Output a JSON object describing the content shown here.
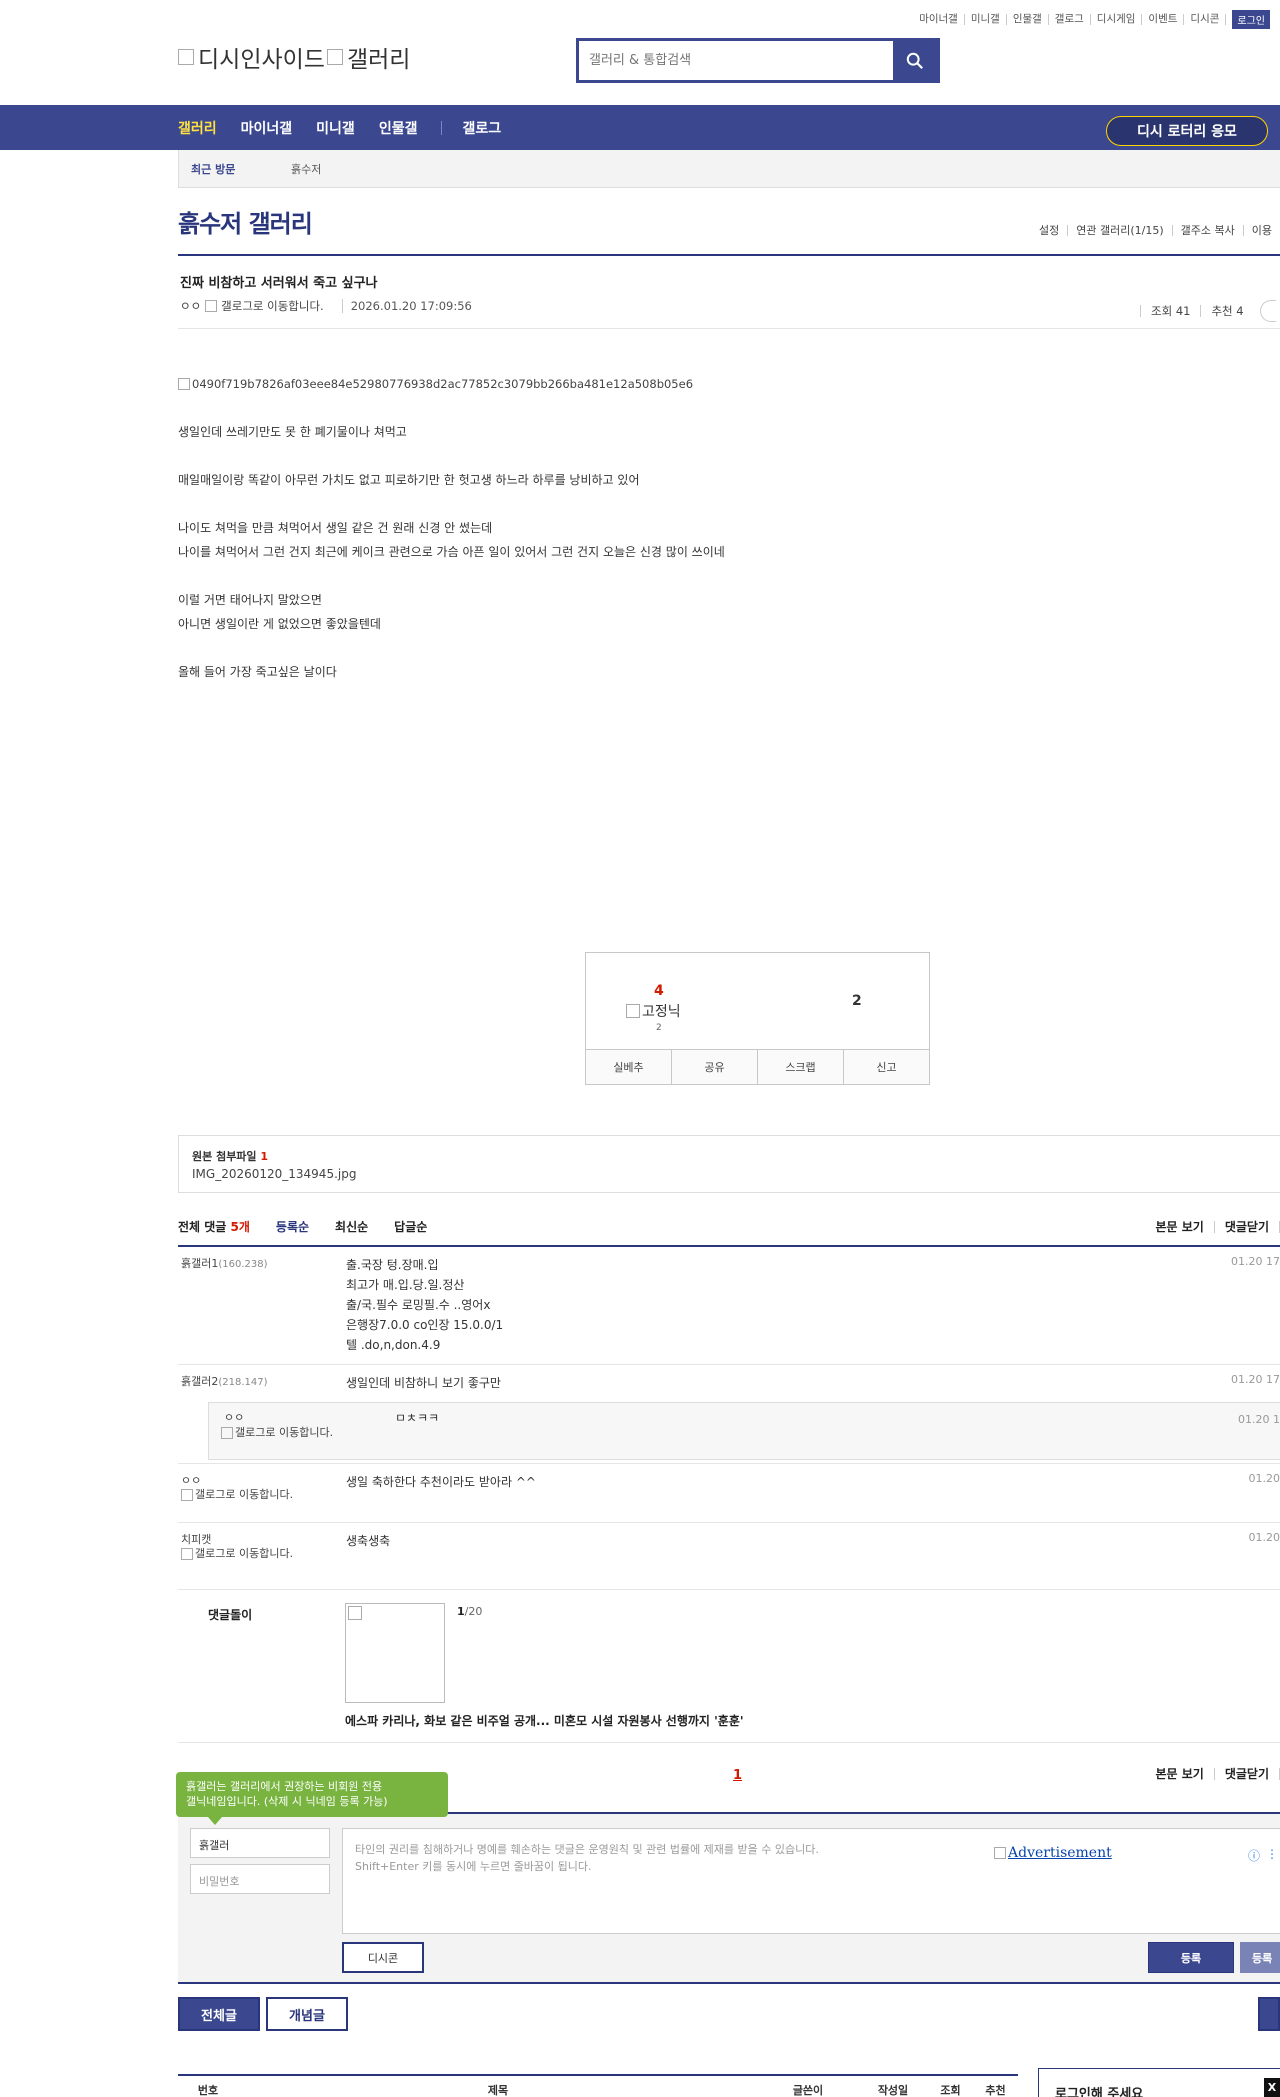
{
  "top_util": {
    "links": [
      "마이너갤",
      "미니갤",
      "인물갤",
      "갤로그",
      "디시게임",
      "이벤트",
      "디시콘"
    ],
    "login": "로그인"
  },
  "header": {
    "logo_alt_1": "디시인사이드",
    "logo_alt_2": "갤러리",
    "search_placeholder": "갤러리 & 통합검색"
  },
  "gnb": {
    "items": [
      "갤러리",
      "마이너갤",
      "미니갤",
      "인물갤",
      "갤로그"
    ],
    "lottery": "디시 로터리 응모",
    "accent": "#ffe13d"
  },
  "recent": {
    "label": "최근 방문",
    "gallery": "흙수저"
  },
  "gallery": {
    "title": "흙수저 갤러리",
    "options": [
      "설정",
      "연관 갤러리(1/15)",
      "갤주소 복사",
      "이용"
    ]
  },
  "post": {
    "title": "진짜 비참하고 서러워서 죽고 싶구나",
    "author": "ㅇㅇ",
    "gallog_alt": "갤로그로 이동합니다.",
    "date": "2026.01.20 17:09:56",
    "views": "조회 41",
    "recommend": "추천 4",
    "image_alt": "0490f719b7826af03eee84e52980776938d2ac77852c3079bb266ba481e12a508b05e6",
    "lines": [
      "생일인데 쓰레기만도 못 한 폐기물이나 쳐먹고",
      "",
      "매일매일이랑 똑같이 아무런 가치도 없고 피로하기만 한 헛고생 하느라 하루를 낭비하고 있어",
      "",
      "나이도 쳐먹을 만큼 쳐먹어서 생일 같은 건 원래 신경 안 썼는데",
      "나이를 쳐먹어서 그런 건지 최근에 케이크 관련으로 가슴 아픈 일이 있어서 그런 건지 오늘은 신경 많이 쓰이네",
      "",
      "이럴 거면 태어나지 말았으면",
      "아니면 생일이란 게 없었으면 좋았을텐데",
      "",
      "올해 들어 가장 죽고싶은 날이다"
    ]
  },
  "recommend_box": {
    "up": "4",
    "fixed_alt": "고정닉",
    "fixed_count": "2",
    "down": "2",
    "actions": [
      "실베추",
      "공유",
      "스크랩",
      "신고"
    ]
  },
  "attachment": {
    "label": "원본 첨부파일",
    "count": "1",
    "file": "IMG_20260120_134945.jpg"
  },
  "comments_header": {
    "all_label": "전체 댓글",
    "count": "5개",
    "sorts": [
      "등록순",
      "최신순",
      "답글순"
    ],
    "right": [
      "본문 보기",
      "댓글닫기"
    ]
  },
  "comments": [
    {
      "nick": "흙갤러1",
      "ip": "(160.238)",
      "lines": [
        "출.국장 텅.장매.입",
        "최고가 매.입.당.일.정산",
        "출/국.필수 로밍필.수 ..영어x",
        "은행장7.0.0 co인장 15.0.0/1",
        "텔 .do,n,don.4.9"
      ],
      "date": "01.20 17"
    },
    {
      "nick": "흙갤러2",
      "ip": "(218.147)",
      "lines": [
        "생일인데 비참하니 보기 좋구만"
      ],
      "date": "01.20 17"
    },
    {
      "nick": "ㅇㅇ",
      "gallog": "갤로그로 이동합니다.",
      "lines": [
        "생일 축하한다 추천이라도 받아라 ^^"
      ],
      "date": "01.20"
    },
    {
      "nick": "치피캣",
      "gallog": "갤로그로 이동합니다.",
      "lines": [
        "생축생축"
      ],
      "date": "01.20"
    }
  ],
  "reply": {
    "nick": "ㅇㅇ",
    "gallog": "갤로그로 이동합니다.",
    "text": "ㅁㅊㅋㅋ",
    "date": "01.20 1"
  },
  "ad_comment": {
    "nick": "댓글돌이",
    "page_current": "1",
    "page_total": "/20",
    "headline": "에스파 카리나, 화보 같은 비주얼 공개... 미혼모 시설 자원봉사 선행까지 '훈훈'"
  },
  "pager": {
    "page": "1",
    "right": [
      "본문 보기",
      "댓글닫기"
    ]
  },
  "tooltip": {
    "line1": "흙갤러는 갤러리에서 권장하는 비회원 전용",
    "line2": "갤닉네임입니다. (삭제 시 닉네임 등록 가능)"
  },
  "write": {
    "nick": "흙갤러",
    "password_placeholder": "비밀번호",
    "notice_line1": "타인의 권리를 침해하거나 명예를 훼손하는 댓글은 운영원칙 및 관련 법률에 제재를 받을 수 있습니다.",
    "notice_line2": "Shift+Enter 키를 동시에 누르면 줄바꿈이 됩니다.",
    "ad_alt": "Advertisement",
    "dccon": "디시콘",
    "submit": "등록",
    "submit2": "등록"
  },
  "list_tabs": [
    "전체글",
    "개념글"
  ],
  "list_headers": [
    "번호",
    "제목",
    "글쓴이",
    "작성일",
    "조회",
    "추천"
  ],
  "login_panel": "로그인해 주세요",
  "close": "X",
  "colors": {
    "primary": "#3b4890",
    "dark": "#29367c",
    "red": "#d31900",
    "green": "#79b440"
  }
}
